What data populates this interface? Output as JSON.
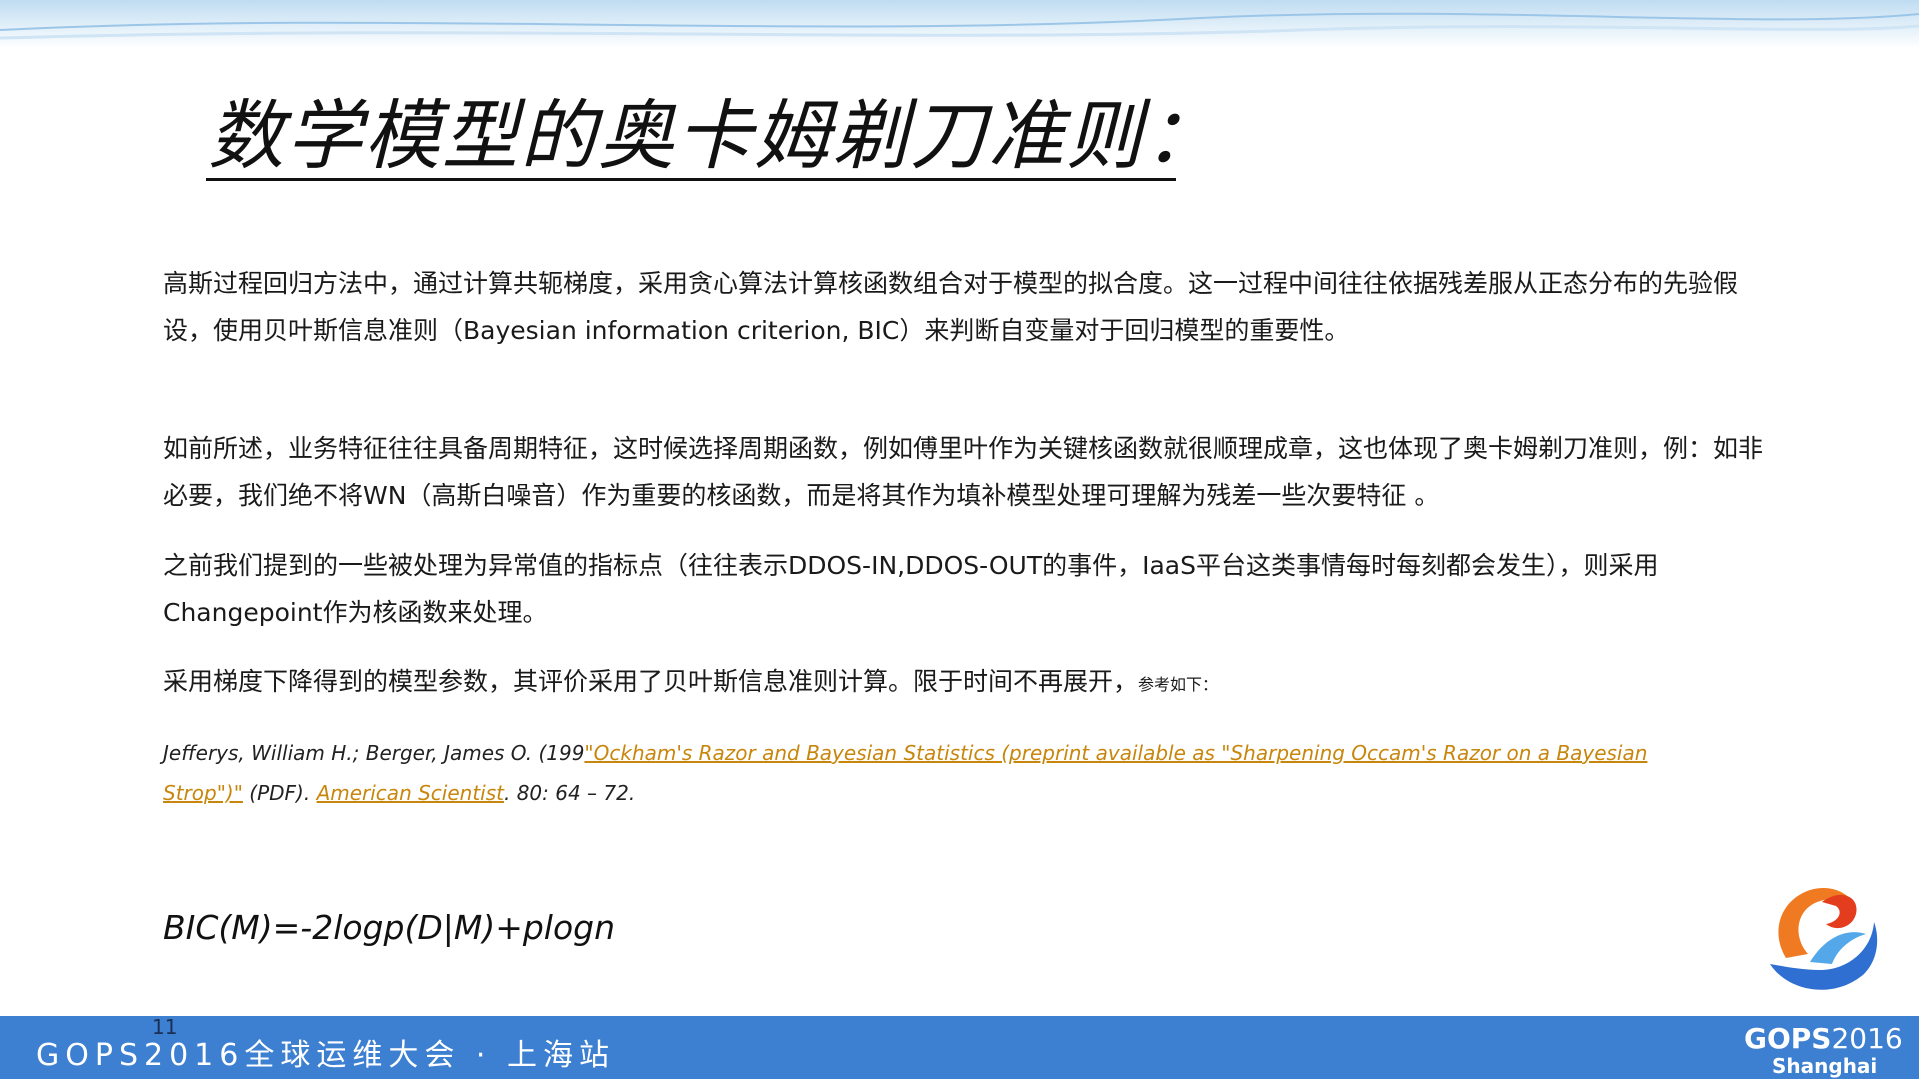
{
  "slide": {
    "title": "数学模型的奥卡姆剃刀准则：",
    "paragraphs": [
      "高斯过程回归方法中，通过计算共轭梯度，采用贪心算法计算核函数组合对于模型的拟合度。这一过程中间往往依据残差服从正态分布的先验假设，使用贝叶斯信息准则（Bayesian information criterion, BIC）来判断自变量对于回归模型的重要性。",
      "如前所述，业务特征往往具备周期特征，这时候选择周期函数，例如傅里叶作为关键核函数就很顺理成章，这也体现了奥卡姆剃刀准则，例：如非必要，我们绝不将WN（高斯白噪音）作为重要的核函数，而是将其作为填补模型处理可理解为残差一些次要特征 。",
      "之前我们提到的一些被处理为异常值的指标点（往往表示DDOS-IN,DDOS-OUT的事件，IaaS平台这类事情每时每刻都会发生），则采用Changepoint作为核函数来处理。"
    ],
    "paragraph4_main": "采用梯度下降得到的模型参数，其评价采用了贝叶斯信息准则计算。限于时间不再展开，",
    "paragraph4_small": "参考如下：",
    "reference": {
      "authors": " Jefferys, William H.; Berger, James O. (199",
      "link_title": "\"Ockham's Razor and Bayesian Statistics (preprint available as \"Sharpening Occam's Razor on a Bayesian Strop\")\"",
      "format": " (PDF). ",
      "journal": "American Scientist",
      "tail": ". 80: 64 – 72."
    },
    "formula": "BIC(M)=-2logp(D|M)+plogn"
  },
  "footer": {
    "event_text": "GOPS2016全球运维大会 · 上海站",
    "page_number": "11",
    "brand_name": "GOPS",
    "brand_year": "2016",
    "brand_city": "Shanghai"
  },
  "colors": {
    "footer_band": "#3d7fd0",
    "link": "#c8860c",
    "logo_blue": "#2f6fd1",
    "logo_orange": "#f07a22"
  }
}
